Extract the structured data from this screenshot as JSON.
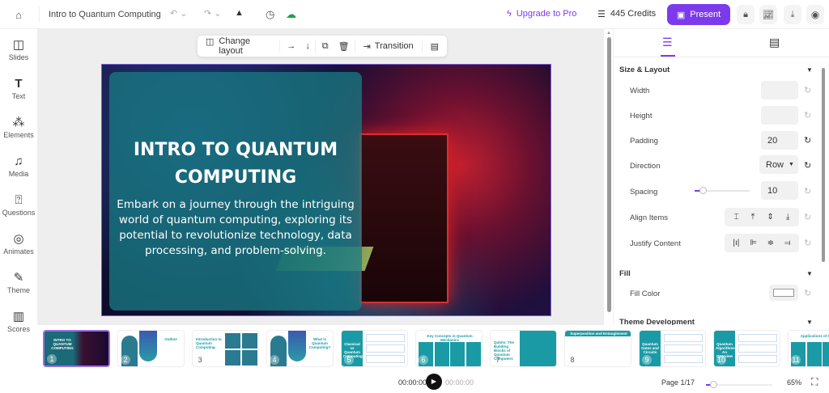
{
  "header": {
    "title": "Intro to Quantum Computing",
    "upgrade_label": "Upgrade to Pro",
    "credits_label": "445 Credits",
    "present_label": "Present",
    "brand_color": "#7c3aed"
  },
  "sidebar": {
    "items": [
      {
        "label": "Slides",
        "icon": "layout-icon"
      },
      {
        "label": "Text",
        "icon": "text-icon"
      },
      {
        "label": "Elements",
        "icon": "shapes-icon"
      },
      {
        "label": "Media",
        "icon": "media-icon"
      },
      {
        "label": "Questions",
        "icon": "question-icon"
      },
      {
        "label": "Animates",
        "icon": "animate-icon"
      },
      {
        "label": "Theme",
        "icon": "brush-icon"
      },
      {
        "label": "Scores",
        "icon": "chart-icon"
      }
    ]
  },
  "toolbar": {
    "change_layout": "Change layout",
    "transition": "Transition"
  },
  "slide": {
    "title": "INTRO TO QUANTUM COMPUTING",
    "body": "Embark on a journey through the intriguing world of quantum computing, exploring its potential to revolutionize technology, data processing, and problem-solving.",
    "overlay_color": "#18788a"
  },
  "panel": {
    "size_layout": "Size & Layout",
    "width_label": "Width",
    "width_value": "",
    "height_label": "Height",
    "height_value": "",
    "padding_label": "Padding",
    "padding_value": "20",
    "direction_label": "Direction",
    "direction_value": "Row",
    "spacing_label": "Spacing",
    "spacing_value": "10",
    "spacing_slider_fraction": 0.15,
    "align_label": "Align Items",
    "justify_label": "Justify Content",
    "fill": "Fill",
    "fill_color_label": "Fill Color",
    "fill_color_value": "#ffffff",
    "theme_dev": "Theme Development"
  },
  "thumbnails": [
    {
      "num": "1",
      "title": "INTRO TO QUANTUM COMPUTING"
    },
    {
      "num": "2",
      "title": "Outline"
    },
    {
      "num": "3",
      "title": "Introduction to Quantum Computing"
    },
    {
      "num": "4",
      "title": "What is Quantum Computing?"
    },
    {
      "num": "5",
      "title": "Classical vs Quantum Computing"
    },
    {
      "num": "6",
      "title": "Key Concepts in Quantum Mechanics"
    },
    {
      "num": "7",
      "title": "Qubits: The Building Blocks of Quantum Computers"
    },
    {
      "num": "8",
      "title": "Superposition and Entanglement"
    },
    {
      "num": "9",
      "title": "Quantum Gates and Circuits"
    },
    {
      "num": "10",
      "title": "Quantum Algorithms: An Overview"
    },
    {
      "num": "11",
      "title": "Applications of Quantum"
    }
  ],
  "footer": {
    "time_current": "00:00:00",
    "time_total": "00:00:00",
    "page": "Page 1/17",
    "zoom": "65%",
    "zoom_fraction": 0.05
  }
}
